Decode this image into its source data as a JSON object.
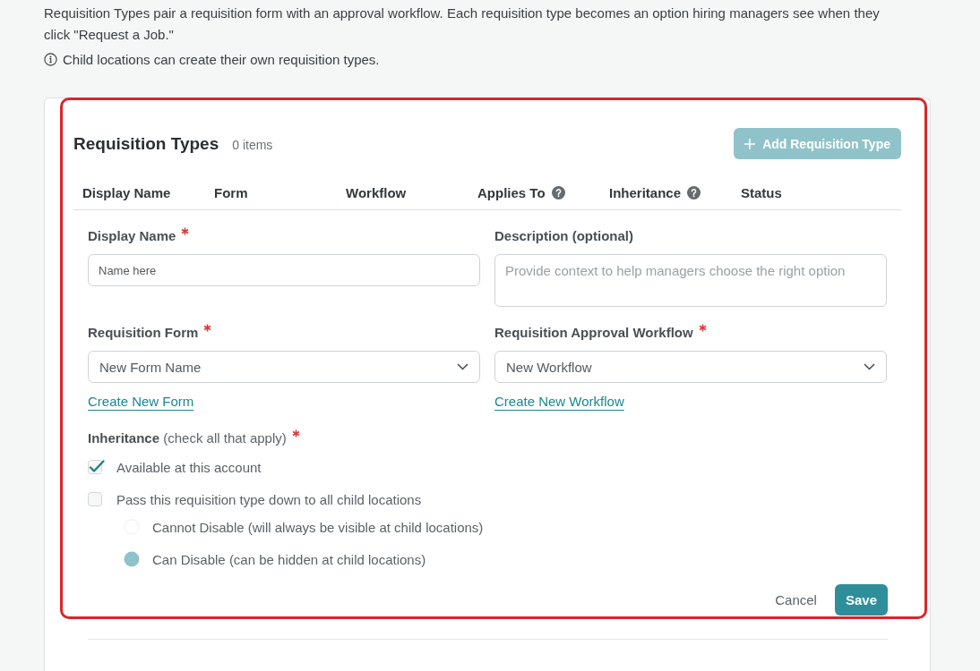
{
  "intro": {
    "text": "Requisition Types pair a requisition form with an approval workflow. Each requisition type becomes an option hiring managers see when they click \"Request a Job.\"",
    "note": "Child locations can create their own requisition types."
  },
  "panel": {
    "title": "Requisition Types",
    "count": "0 items",
    "add_button": {
      "label": "Add Requisition Type",
      "disabled": true
    }
  },
  "table": {
    "columns": [
      {
        "label": "Display Name",
        "help": false
      },
      {
        "label": "Form",
        "help": false
      },
      {
        "label": "Workflow",
        "help": false
      },
      {
        "label": "Applies To",
        "help": true
      },
      {
        "label": "Inheritance",
        "help": true
      },
      {
        "label": "Status",
        "help": false
      }
    ]
  },
  "form": {
    "fields": [
      {
        "kind": "input",
        "label": "Display Name",
        "required": true,
        "placeholder": "Name here"
      },
      {
        "kind": "textarea",
        "label": "Description (optional)",
        "required": false,
        "placeholder": "Provide context to help managers choose the right option"
      },
      {
        "kind": "select",
        "label": "Requisition Form",
        "required": true,
        "value": "New Form Name",
        "link": "Create New Form"
      },
      {
        "kind": "select",
        "label": "Requisition Approval Workflow",
        "required": true,
        "value": "New Workflow",
        "link": "Create New Workflow"
      }
    ],
    "inheritance": {
      "label": "**Inheritance** (check all that apply)",
      "required": true,
      "options": [
        {
          "kind": "checkbox",
          "label": "Available at this account",
          "checked": true
        },
        {
          "kind": "checkbox",
          "label": "Pass this requisition type down to all child locations",
          "checked": false,
          "children": [
            {
              "kind": "radio",
              "label": "Cannot Disable (will always be visible at child locations)",
              "selected": false,
              "disabled": true
            },
            {
              "kind": "radio",
              "label": "Can Disable (can be hidden at child locations)",
              "selected": true,
              "disabled": true
            }
          ]
        }
      ]
    }
  },
  "actions": [
    {
      "kind": "text",
      "label": "Cancel"
    },
    {
      "kind": "primary",
      "label": "Save"
    }
  ]
}
